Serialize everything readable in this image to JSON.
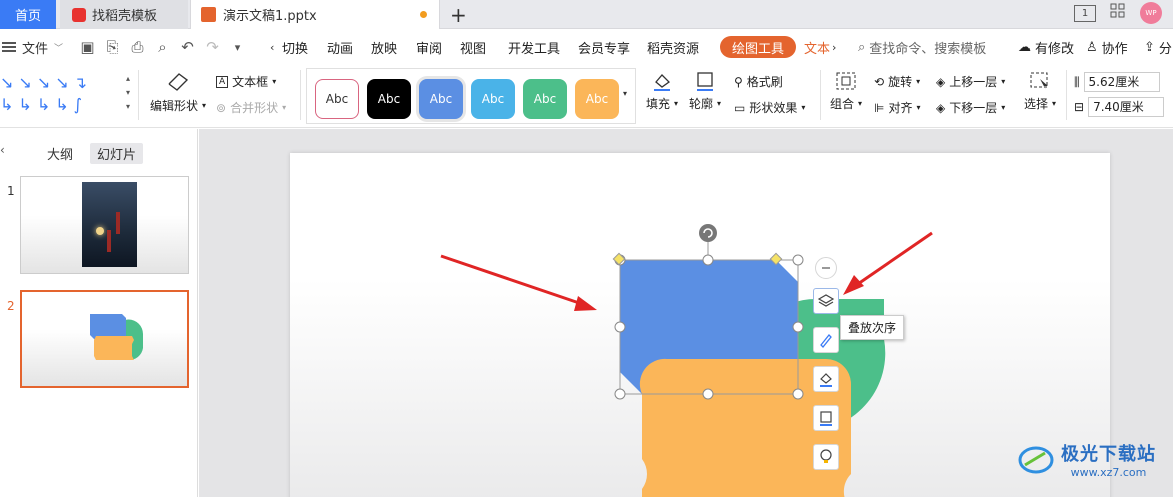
{
  "tabs": {
    "home": "首页",
    "template": "找稻壳模板",
    "document": "演示文稿1.pptx"
  },
  "window": {
    "avatar": "WP"
  },
  "menu": {
    "file": "文件",
    "items": [
      "切换",
      "动画",
      "放映",
      "审阅",
      "视图",
      "开发工具",
      "会员专享",
      "稻壳资源"
    ],
    "drawing_tool": "绘图工具",
    "text_tab": "文本",
    "search": "查找命令、搜索模板",
    "has_changes": "有修改",
    "collab": "协作",
    "share": "分"
  },
  "ribbon": {
    "edit_shape": "编辑形状",
    "text_box": "文本框",
    "merge_shape": "合并形状",
    "style_label": "Abc",
    "fill": "填充",
    "outline": "轮廓",
    "format_painter": "格式刷",
    "shape_effects": "形状效果",
    "group": "组合",
    "rotate": "旋转",
    "align": "对齐",
    "bring_forward": "上移一层",
    "send_backward": "下移一层",
    "select": "选择",
    "height": "5.62厘米",
    "width": "7.40厘米"
  },
  "left_panel": {
    "tab_outline": "大纲",
    "tab_slides": "幻灯片",
    "slide_numbers": [
      "1",
      "2"
    ]
  },
  "canvas": {
    "tooltip": "叠放次序"
  },
  "watermark": {
    "name": "极光下载站",
    "url": "www.xz7.com"
  },
  "colors": {
    "accent": "#e4642e",
    "home_tab": "#3a7bf5",
    "shape_blue": "#5b8fe3",
    "shape_green": "#4cbf8a",
    "shape_orange": "#fbb659",
    "arrow": "#e02525"
  }
}
